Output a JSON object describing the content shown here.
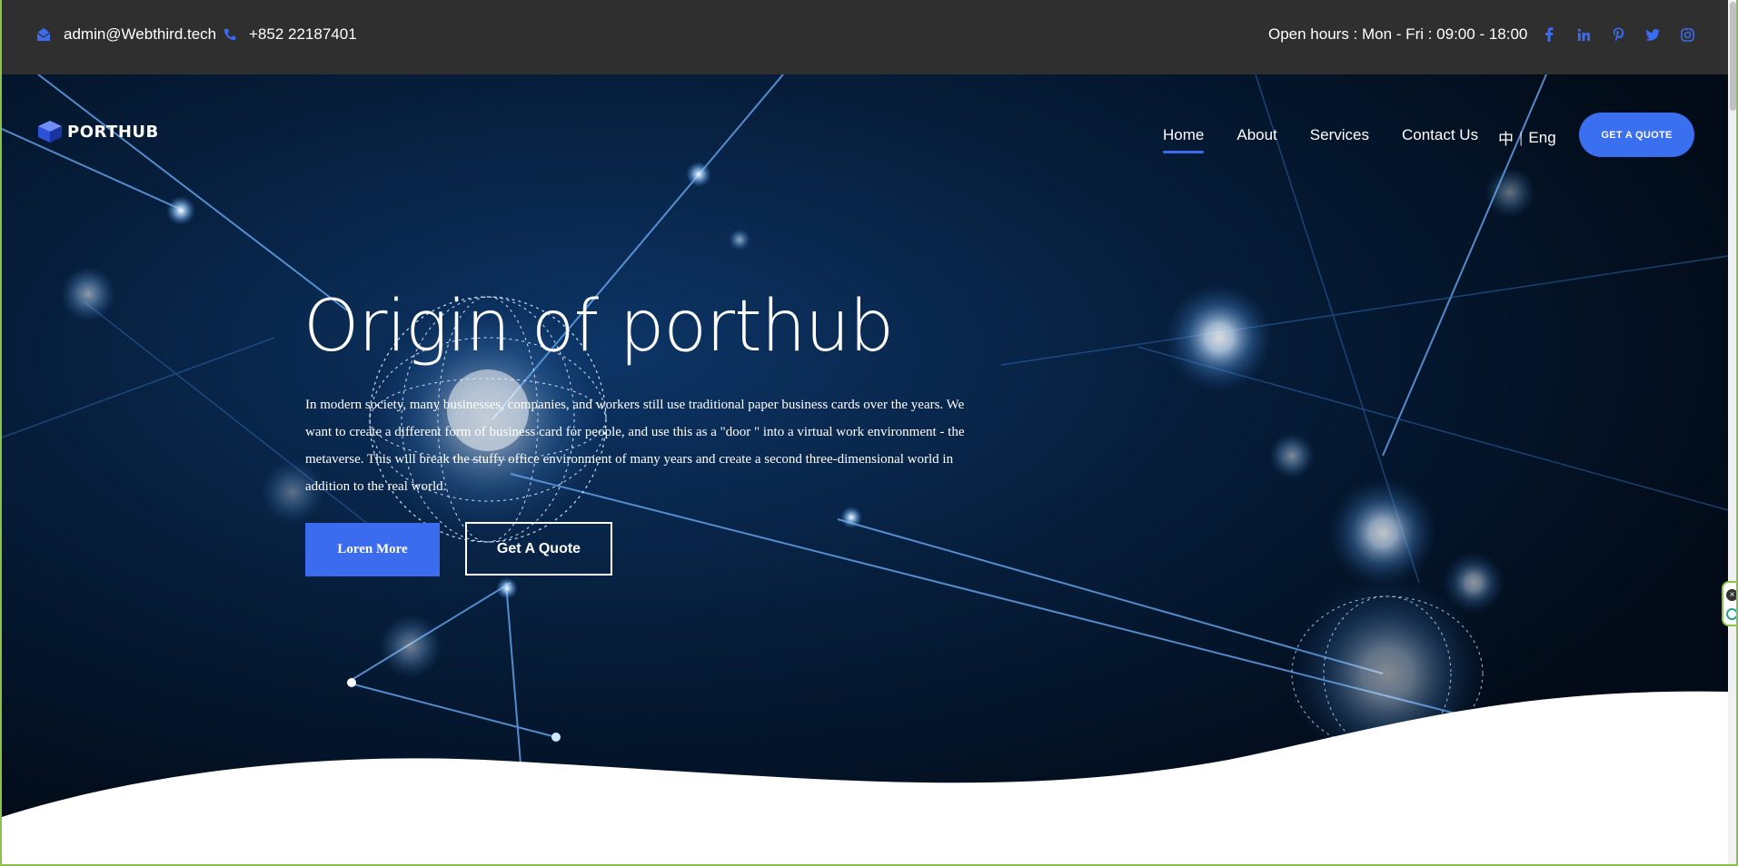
{
  "topbar": {
    "email": "admin@Webthird.tech",
    "phone": "+852 22187401",
    "hours": "Open hours : Mon - Fri : 09:00 - 18:00",
    "social_icons": [
      "facebook-icon",
      "linkedin-icon",
      "pinterest-icon",
      "twitter-icon",
      "instagram-icon"
    ],
    "icon_color": "#3b6cf0"
  },
  "header": {
    "logo": "PORTHUB",
    "nav": [
      {
        "label": "Home",
        "active": true
      },
      {
        "label": "About",
        "active": false
      },
      {
        "label": "Services",
        "active": false
      },
      {
        "label": "Contact Us",
        "active": false
      }
    ],
    "lang_zh": "中",
    "lang_sep": "|",
    "lang_en": "Eng",
    "cta": "GET A QUOTE"
  },
  "hero": {
    "title": "Origin of porthub",
    "description": "In modern society, many businesses, companies, and workers still use traditional paper business cards over the years. We want to create a different form of business card for people, and use this as a \"door \" into a virtual work environment - the metaverse. This will break the stuffy office environment of many years and create a second three-dimensional world in addition to the real world.",
    "primary_button": "Loren More",
    "secondary_button": "Get A Quote"
  },
  "colors": {
    "accent": "#3b6cf0",
    "topbar_bg": "#2f2f2f",
    "hero_bg": "#041326"
  }
}
